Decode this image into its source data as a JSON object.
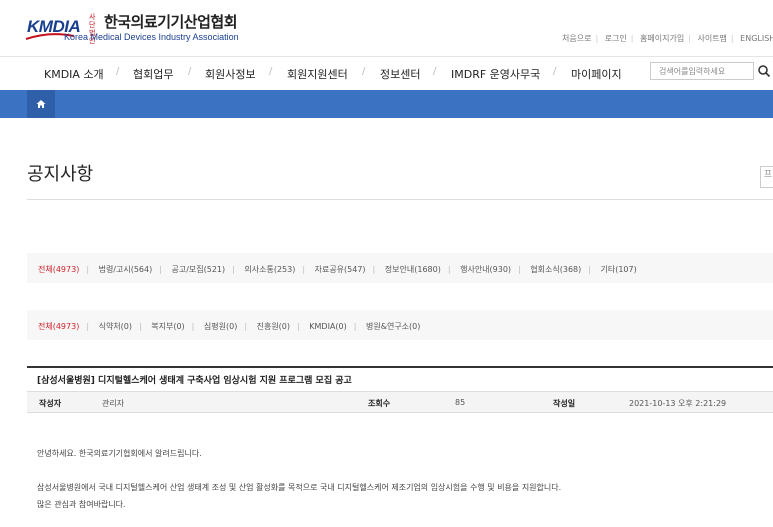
{
  "logo": {
    "mark": "KMDIA",
    "corp": "사단법인",
    "name_ko": "한국의료기기산업협회",
    "name_en": "Korea Medical Devices Industry Association"
  },
  "util_links": [
    "처음으로",
    "로그인",
    "홈페이지가입",
    "사이트맵",
    "ENGLISH"
  ],
  "gnb": [
    "KMDIA 소개",
    "협회업무",
    "회원사정보",
    "회원지원센터",
    "정보센터",
    "IMDRF 운영사무국",
    "마이페이지"
  ],
  "search": {
    "placeholder": "검색어를입력하세요"
  },
  "page_title": "공지사항",
  "print_label": "프",
  "filter1": [
    "전체(4973)",
    "법령/고시(564)",
    "공고/모집(521)",
    "의사소통(253)",
    "자료공유(547)",
    "정보안내(1680)",
    "행사안내(930)",
    "협회소식(368)",
    "기타(107)"
  ],
  "filter2": [
    "전체(4973)",
    "식약처(0)",
    "복지부(0)",
    "심평원(0)",
    "진흥원(0)",
    "KMDIA(0)",
    "병원&연구소(0)"
  ],
  "post": {
    "title": "[삼성서울병원] 디지털헬스케어 생태계 구축사업 임상시험 지원 프로그램 모집 공고",
    "author_label": "작성자",
    "author": "관리자",
    "views_label": "조회수",
    "views": "85",
    "date_label": "작성일",
    "date": "2021-10-13 오후 2:21:29",
    "body": [
      "안녕하세요. 한국의료기기협회에서 알려드립니다.",
      "삼성서울병원에서 국내 디지털헬스케어 산업 생태계 조성 및 산업 활성화를 목적으로 국내 디지털헬스케어 제조기업의 임상시험을 수행 및 비용을 지원합니다.",
      "많은 관심과 참여바랍니다."
    ]
  },
  "colors": {
    "brand_blue": "#1a3f8f",
    "bar_blue": "#3b72c1",
    "accent_red": "#d2232a"
  }
}
